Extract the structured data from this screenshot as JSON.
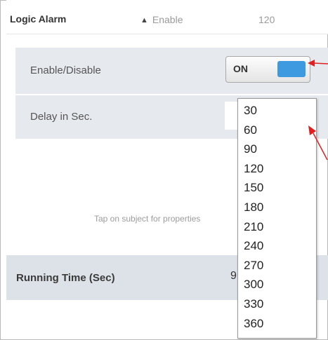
{
  "header": {
    "title": "Logic Alarm",
    "enable_label": "Enable",
    "value": "120",
    "triangle_icon": "triangle-up-icon"
  },
  "properties": {
    "enable_disable_label": "Enable/Disable",
    "toggle_state": "ON",
    "toggle_color": "#3d9ae0",
    "delay_label": "Delay in Sec."
  },
  "hint": "Tap on subject for properties",
  "running": {
    "label": "Running Time (Sec)",
    "value": "9"
  },
  "dropdown": {
    "options": [
      "30",
      "60",
      "90",
      "120",
      "150",
      "180",
      "210",
      "240",
      "270",
      "300",
      "330",
      "360"
    ]
  },
  "annotation_color": "#e02020"
}
